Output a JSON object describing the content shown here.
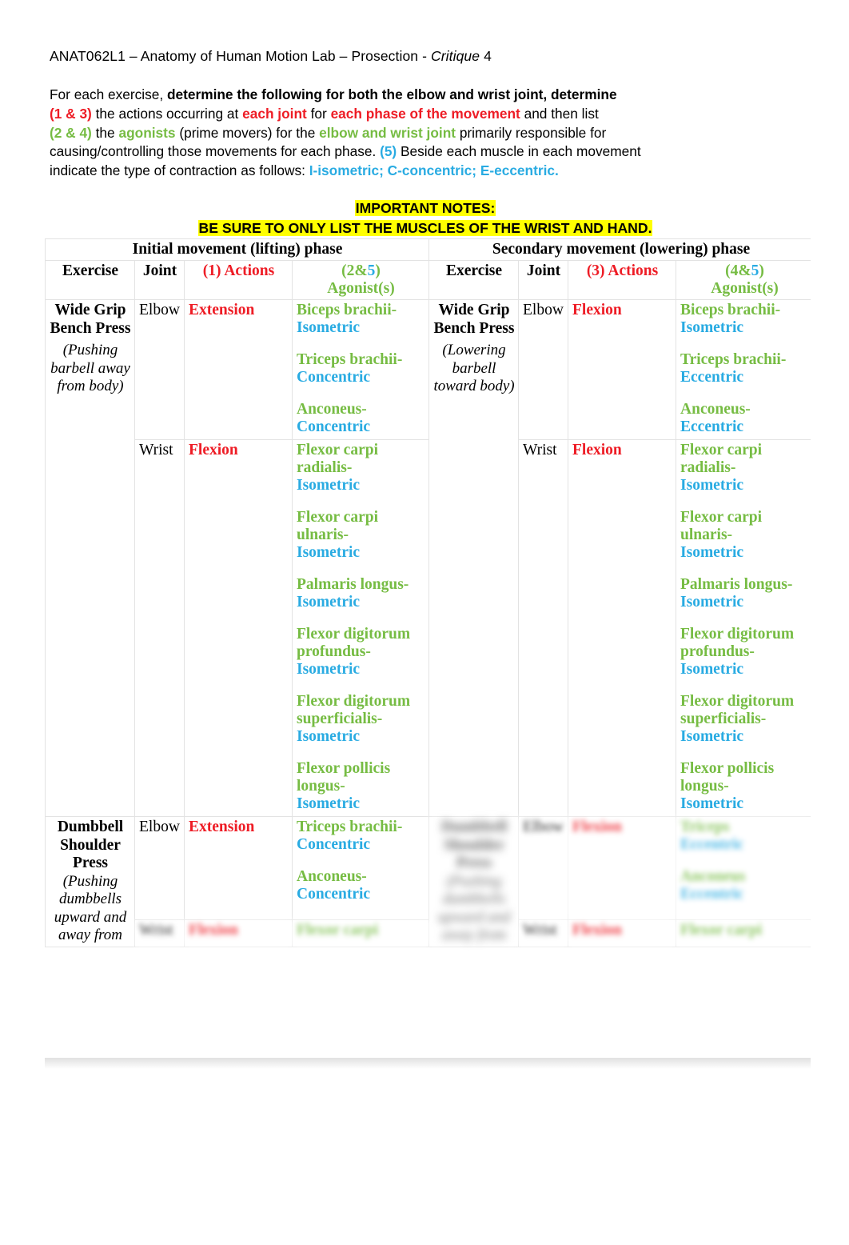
{
  "document": {
    "header": {
      "course_code": "ANAT062L1",
      "dash1": " – ",
      "course_name": "Anatomy of Human Motion Lab",
      "dash2": " – ",
      "section": "Prosection - ",
      "assignment_italic": "Critique",
      "assignment_number": " 4"
    },
    "instructions": {
      "line1_plain": "For each exercise, ",
      "line1_bold": "determine the following for both the elbow and wrist joint, determine",
      "l2_red_a": "(1 & 3)",
      "l2_plain_a": " the actions occurring at ",
      "l2_red_b": "each joint",
      "l2_plain_b": " for ",
      "l2_red_c": "each phase of the movement",
      "l2_plain_c": " and then list",
      "l3_green_a": "(2 & 4)",
      "l3_plain_a": " the ",
      "l3_green_b": "agonists",
      "l3_plain_b": " (prime movers) for the ",
      "l3_green_c": "elbow and wrist joint",
      "l3_plain_c": " primarily responsible for",
      "l4_plain_a": "causing/controlling those movements for each phase. ",
      "l4_cyan_a": "(5)",
      "l4_plain_b": " Beside each muscle in each movement",
      "l5_plain_a": "indicate the type of contraction as follows: ",
      "l5_cyan_a": "I-isometric; C-concentric; E-eccentric."
    },
    "notes": {
      "title": "IMPORTANT NOTES:",
      "body": "BE SURE TO ONLY LIST THE MUSCLES OF THE WRIST AND HAND."
    }
  },
  "colors": {
    "red": "#ee1c25",
    "green": "#76bc43",
    "cyan": "#29abe2",
    "highlight": "#ffff00",
    "cell_gray": "#eaeaea",
    "border": "#e3e3e3"
  },
  "table": {
    "phase_headers": {
      "initial": "Initial movement (lifting) phase",
      "secondary": "Secondary movement (lowering) phase"
    },
    "column_headers": {
      "exercise": "Exercise",
      "joint": "Joint",
      "actions_initial_num": "(1)",
      "actions_initial_label": " Actions",
      "actions_secondary_num": "(3)",
      "actions_secondary_label": " Actions",
      "agonist_initial_num_green": "(2&",
      "agonist_initial_num_cyan": "5",
      "agonist_initial_num_close": ")",
      "agonist_secondary_num_green": "(4&",
      "agonist_secondary_num_cyan": "5",
      "agonist_secondary_num_close": ")",
      "agonist_label": "Agonist(s)"
    },
    "rows": [
      {
        "exercise_left_name": "Wide Grip Bench Press",
        "exercise_left_note": "(Pushing barbell away from body)",
        "exercise_right_name": "Wide Grip Bench Press",
        "exercise_right_note": "(Lowering barbell toward body)",
        "elbow": {
          "joint": "Joint",
          "left_joint": "Elbow",
          "left_action": "Extension",
          "left_agonists": [
            {
              "name": "Biceps brachii-",
              "type": "Isometric"
            },
            {
              "name": "Triceps brachii-",
              "type": "Concentric"
            },
            {
              "name": "Anconeus-",
              "type": "Concentric"
            }
          ],
          "right_joint": "Elbow",
          "right_action": "Flexion",
          "right_agonists": [
            {
              "name": "Biceps brachii-",
              "type": "Isometric"
            },
            {
              "name": "Triceps brachii-",
              "type": "Eccentric"
            },
            {
              "name": "Anconeus-",
              "type": "Eccentric"
            }
          ]
        },
        "wrist": {
          "left_joint": "Wrist",
          "left_action": "Flexion",
          "left_agonists": [
            {
              "name": "Flexor carpi radialis-",
              "type": "Isometric"
            },
            {
              "name": "Flexor carpi ulnaris-",
              "type": "Isometric"
            },
            {
              "name": "Palmaris longus-",
              "type": "Isometric"
            },
            {
              "name": "Flexor digitorum profundus-",
              "type": "Isometric"
            },
            {
              "name": "Flexor digitorum superficialis-",
              "type": "Isometric"
            },
            {
              "name": "Flexor pollicis longus-",
              "type": "Isometric"
            }
          ],
          "right_joint": "Wrist",
          "right_action": "Flexion",
          "right_agonists": [
            {
              "name": "Flexor carpi radialis-",
              "type": "Isometric"
            },
            {
              "name": "Flexor carpi ulnaris-",
              "type": "Isometric"
            },
            {
              "name": "Palmaris longus-",
              "type": "Isometric"
            },
            {
              "name": "Flexor digitorum profundus-",
              "type": "Isometric"
            },
            {
              "name": "Flexor digitorum superficialis-",
              "type": "Isometric"
            },
            {
              "name": "Flexor pollicis longus-",
              "type": "Isometric"
            }
          ]
        }
      },
      {
        "exercise_left_name": "Dumbbell Shoulder Press",
        "exercise_left_note": "(Pushing dumbbells upward and away from",
        "elbow": {
          "left_joint": "Elbow",
          "left_action": "Extension",
          "left_agonists": [
            {
              "name": "Triceps brachii-",
              "type": "Concentric"
            },
            {
              "name": "Anconeus-",
              "type": "Concentric"
            }
          ],
          "right_joint": "Elbow",
          "right_action": "Flexion",
          "right_agonists": [
            {
              "name": "Triceps",
              "type": "Eccentric"
            },
            {
              "name": "Anconeus",
              "type": "Eccentric"
            }
          ]
        },
        "wrist": {
          "left_joint": "Wrist",
          "left_action": "Flexion",
          "left_agonists": [
            {
              "name": "Flexor carpi",
              "type": ""
            }
          ],
          "right_joint": "Wrist",
          "right_action": "Flexion",
          "right_agonists": [
            {
              "name": "Flexor carpi",
              "type": ""
            }
          ]
        }
      }
    ]
  }
}
